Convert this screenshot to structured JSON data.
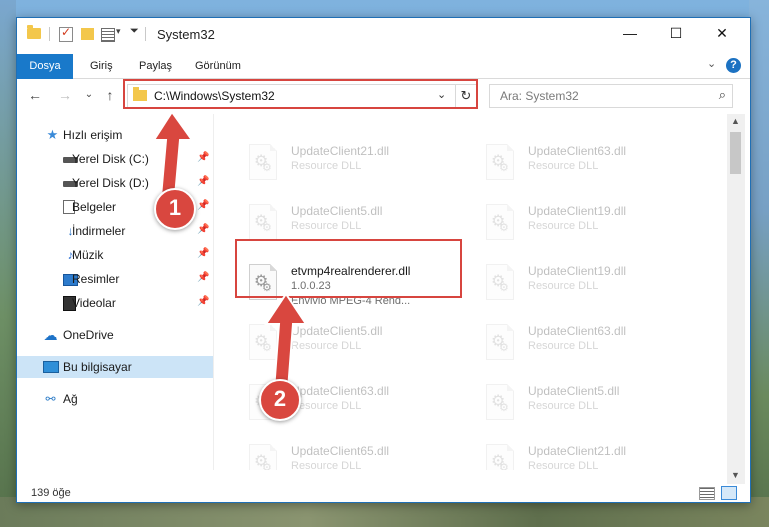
{
  "window": {
    "title": "System32"
  },
  "titlebar": {
    "minimize": "—",
    "maximize": "☐",
    "close": "✕"
  },
  "ribbon": {
    "tabs": [
      "Dosya",
      "Giriş",
      "Paylaş",
      "Görünüm"
    ],
    "collapse_caret": "⌄",
    "help": "?"
  },
  "navigation": {
    "back": "←",
    "forward": "→",
    "recent": "⌄",
    "up": "↑",
    "address_path": "C:\\Windows\\System32",
    "address_chevron": "⌄",
    "refresh": "↻",
    "search_placeholder": "Ara: System32",
    "search_icon": "⌕"
  },
  "sidebar": {
    "items": [
      {
        "label": "Hızlı erişim",
        "icon": "star-icon",
        "glyph": "★",
        "pinned": false
      },
      {
        "label": "Yerel Disk (C:)",
        "icon": "drive-icon",
        "glyph": "",
        "pinned": true
      },
      {
        "label": "Yerel Disk (D:)",
        "icon": "drive-icon",
        "glyph": "",
        "pinned": true
      },
      {
        "label": "Belgeler",
        "icon": "documents-icon",
        "glyph": "",
        "pinned": true
      },
      {
        "label": "İndirmeler",
        "icon": "download-icon",
        "glyph": "↓",
        "pinned": true
      },
      {
        "label": "Müzik",
        "icon": "music-icon",
        "glyph": "♪",
        "pinned": true
      },
      {
        "label": "Resimler",
        "icon": "pictures-icon",
        "glyph": "",
        "pinned": true
      },
      {
        "label": "Videolar",
        "icon": "videos-icon",
        "glyph": "",
        "pinned": true
      },
      {
        "label": "OneDrive",
        "icon": "cloud-icon",
        "glyph": "☁",
        "pinned": false
      },
      {
        "label": "Bu bilgisayar",
        "icon": "computer-icon",
        "glyph": "",
        "pinned": false,
        "selected": true
      },
      {
        "label": "Ağ",
        "icon": "network-icon",
        "glyph": "⚯",
        "pinned": false
      }
    ],
    "pin_glyph": "📌"
  },
  "files": {
    "faded": [
      {
        "name": "UpdateClient21.dll",
        "type": "Resource DLL"
      },
      {
        "name": "UpdateClient63.dll",
        "type": "Resource DLL"
      },
      {
        "name": "UpdateClient5.dll",
        "type": "Resource DLL"
      },
      {
        "name": "UpdateClient19.dll",
        "type": "Resource DLL"
      },
      {
        "name": "UpdateClient19.dll",
        "type": "Resource DLL"
      },
      {
        "name": "UpdateClient5.dll",
        "type": "Resource DLL"
      },
      {
        "name": "UpdateClient63.dll",
        "type": "Resource DLL"
      },
      {
        "name": "UpdateClient63.dll",
        "type": "Resource DLL"
      },
      {
        "name": "UpdateClient5.dll",
        "type": "Resource DLL"
      },
      {
        "name": "UpdateClient65.dll",
        "type": "Resource DLL"
      },
      {
        "name": "UpdateClient21.dll",
        "type": "Resource DLL"
      }
    ],
    "highlighted": {
      "name": "etvmp4realrenderer.dll",
      "version": "1.0.0.23",
      "description": "Envivio MPEG-4 Rend..."
    }
  },
  "annotations": {
    "step1": "1",
    "step2": "2",
    "color": "#d9473f"
  },
  "statusbar": {
    "item_count": "139 öğe"
  },
  "colors": {
    "accent": "#1979ca",
    "selection": "#cce4f7",
    "highlight_box": "#d7453f"
  }
}
